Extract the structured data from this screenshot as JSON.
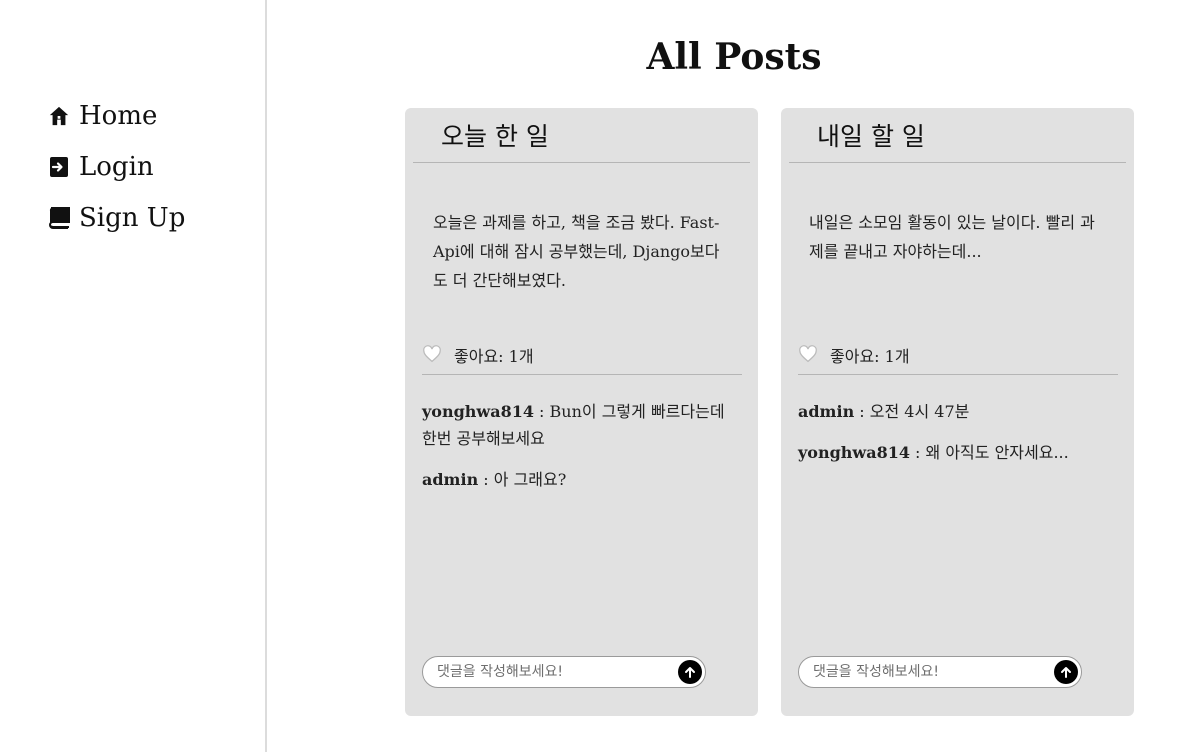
{
  "sidebar": {
    "items": [
      {
        "label": "Home",
        "icon": "home-icon"
      },
      {
        "label": "Login",
        "icon": "login-icon"
      },
      {
        "label": "Sign Up",
        "icon": "book-icon"
      }
    ]
  },
  "page": {
    "title": "All Posts"
  },
  "posts": [
    {
      "title": "오늘 한 일",
      "body": "오늘은 과제를 하고, 책을 조금 봤다. Fast-Api에 대해 잠시 공부했는데, Django보다도 더 간단해보였다.",
      "likes_text": "좋아요: 1개",
      "comments": [
        {
          "author": "yonghwa814",
          "text": " : Bun이 그렇게 빠르다는데 한번 공부해보세요"
        },
        {
          "author": "admin",
          "text": " : 아 그래요?"
        }
      ],
      "comment_placeholder": "댓글을 작성해보세요!"
    },
    {
      "title": "내일 할 일",
      "body": "내일은 소모임 활동이 있는 날이다. 빨리 과제를 끝내고 자야하는데...",
      "likes_text": "좋아요: 1개",
      "comments": [
        {
          "author": "admin",
          "text": " : 오전 4시 47분"
        },
        {
          "author": "yonghwa814",
          "text": " : 왜 아직도 안자세요..."
        }
      ],
      "comment_placeholder": "댓글을 작성해보세요!"
    }
  ],
  "colors": {
    "card_bg": "#e1e1e1",
    "divider": "#b5b5b5",
    "send_button": "#000000"
  }
}
